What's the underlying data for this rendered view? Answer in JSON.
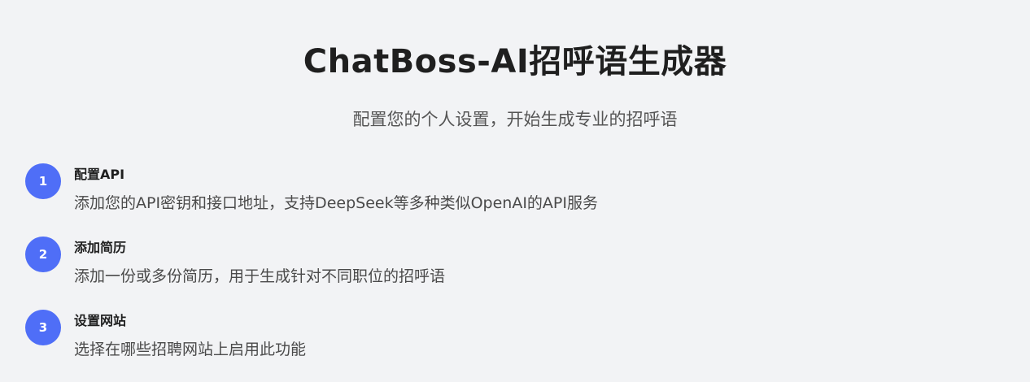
{
  "header": {
    "title": "ChatBoss-AI招呼语生成器",
    "subtitle": "配置您的个人设置，开始生成专业的招呼语"
  },
  "steps": [
    {
      "number": "1",
      "title": "配置API",
      "description": "添加您的API密钥和接口地址，支持DeepSeek等多种类似OpenAI的API服务"
    },
    {
      "number": "2",
      "title": "添加简历",
      "description": "添加一份或多份简历，用于生成针对不同职位的招呼语"
    },
    {
      "number": "3",
      "title": "设置网站",
      "description": "选择在哪些招聘网站上启用此功能"
    }
  ],
  "colors": {
    "accent": "#4f6ef7",
    "background": "#f2f3f5"
  }
}
